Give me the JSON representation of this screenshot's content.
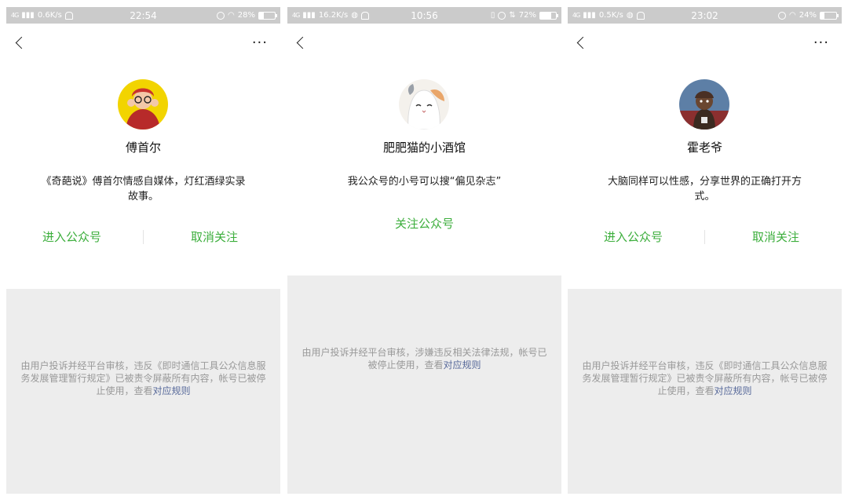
{
  "screens": [
    {
      "status_bar": {
        "network": "4G",
        "speed": "0.6K/s",
        "time": "22:54",
        "battery": "28%"
      },
      "profile_name": "傅首尔",
      "intro": "《奇葩说》傅首尔情感自媒体，灯红酒绿实录故事。",
      "actions": [
        "进入公众号",
        "取消关注"
      ],
      "notice_text": "由用户投诉并经平台审核，违反《即时通信工具公众信息服务发展管理暂行规定》已被责令屏蔽所有内容，帐号已被停止使用，查看",
      "notice_link": "对应规则"
    },
    {
      "status_bar": {
        "network": "4G",
        "speed": "16.2K/s",
        "time": "10:56",
        "battery": "72%"
      },
      "profile_name": "肥肥猫的小酒馆",
      "intro": "我公众号的小号可以搜“偏见杂志”",
      "actions": [
        "关注公众号"
      ],
      "notice_text": "由用户投诉并经平台审核，涉嫌违反相关法律法规，帐号已被停止使用，查看",
      "notice_link": "对应规则"
    },
    {
      "status_bar": {
        "network": "4G",
        "speed": "0.5K/s",
        "time": "23:02",
        "battery": "24%"
      },
      "profile_name": "霍老爷",
      "intro": "大脑同样可以性感，分享世界的正确打开方式。",
      "actions": [
        "进入公众号",
        "取消关注"
      ],
      "notice_text": "由用户投诉并经平台审核，违反《即时通信工具公众信息服务发展管理暂行规定》已被责令屏蔽所有内容，帐号已被停止使用，查看",
      "notice_link": "对应规则"
    }
  ],
  "colors": {
    "accent_green": "#3cae3c",
    "link_blue": "#57699a",
    "status_bar_gray": "#cbcbcb",
    "panel_gray": "#ededed"
  },
  "icons": [
    "back-icon",
    "more-icon",
    "signal-icon",
    "alarm-icon",
    "wifi-icon",
    "battery-icon"
  ]
}
